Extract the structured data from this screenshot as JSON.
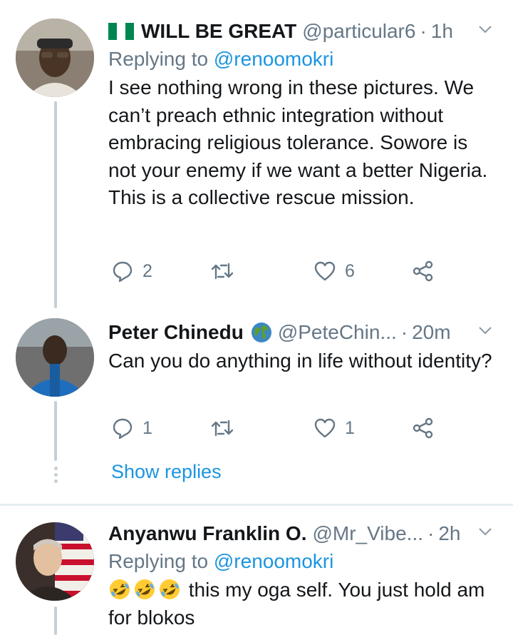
{
  "tweets": [
    {
      "name": "WILL BE GREAT",
      "handle": "@particular6",
      "dot": "·",
      "time": "1h",
      "replying_prefix": "Replying to",
      "replying_to": "@renoomokri",
      "text": "I see nothing wrong in these pictures. We can’t preach ethnic integration without embracing religious tolerance. Sowore is not your enemy if we want a better Nigeria. This is a collective rescue mission.",
      "replies": "2",
      "retweets": "",
      "likes": "6",
      "flag_icon": "nigeria-flag-icon"
    },
    {
      "name": "Peter Chinedu",
      "handle": "@PeteChin...",
      "dot": "·",
      "time": "20m",
      "text": "Can you do anything in life without identity?",
      "replies": "1",
      "retweets": "",
      "likes": "1",
      "badge_icon": "globe-icon"
    },
    {
      "name": "Anyanwu Franklin O.",
      "handle": "@Mr_Vibe...",
      "dot": "·",
      "time": "2h",
      "replying_prefix": "Replying to",
      "replying_to": "@renoomokri",
      "text_after_emoji": "this my oga self. You just hold am for blokos",
      "emoji_icon": "rolling-on-floor-laughing-emoji"
    }
  ],
  "show_replies": "Show replies",
  "colors": {
    "link": "#1b95e0",
    "secondary": "#657786",
    "thread_line": "#c4cfd6",
    "divider": "#e6ecf0"
  }
}
